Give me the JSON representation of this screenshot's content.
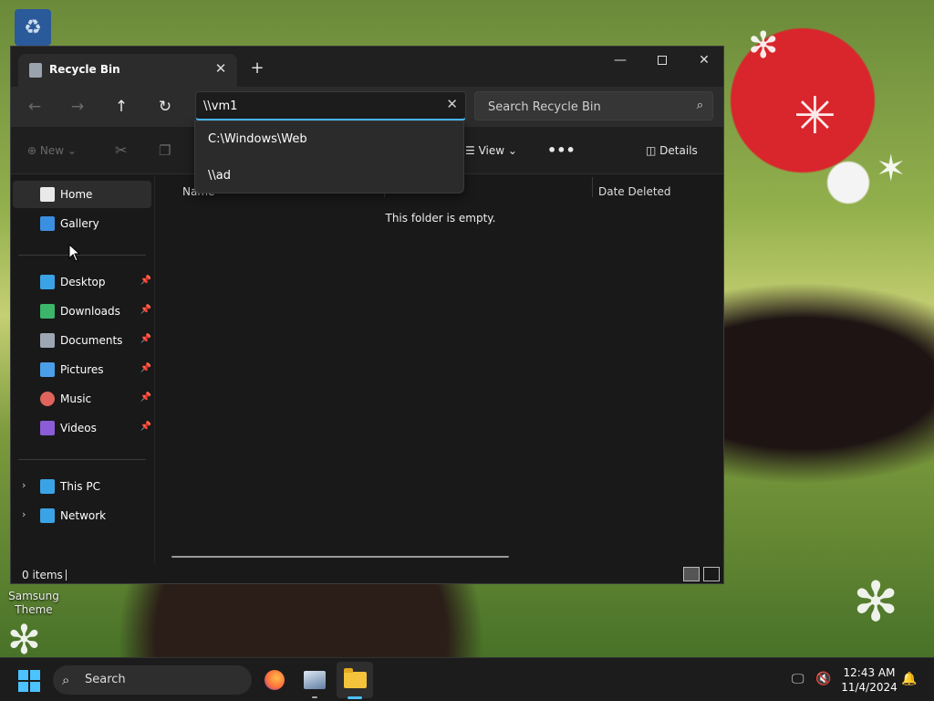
{
  "desktop": {
    "recycle_bin_icon": "recycle-bin-icon",
    "theme_label": "Samsung Theme"
  },
  "window": {
    "tab_title": "Recycle Bin",
    "tab_icon": "recycle-bin-icon",
    "tab_close": "✕",
    "new_tab": "+",
    "minimize": "—",
    "close": "✕"
  },
  "navigation": {
    "back": "←",
    "forward": "→",
    "up": "↑",
    "refresh": "↻",
    "address_value": "\\\\vm1",
    "address_clear": "✕",
    "search_placeholder": "Search Recycle Bin",
    "search_icon": "⌕"
  },
  "address_suggestions": [
    {
      "label": "C:\\Windows\\Web"
    },
    {
      "label": "\\\\ad"
    }
  ],
  "commandbar": {
    "new_label": "New",
    "new_icon": "⊕",
    "cut_icon": "✂",
    "copy_icon": "❐",
    "view_label": "View",
    "more_label": "•••",
    "details_label": "Details"
  },
  "sidebar": {
    "items": [
      {
        "label": "Home",
        "icon": "home-icon",
        "color": "#e9e9e9"
      },
      {
        "label": "Gallery",
        "icon": "gallery-icon",
        "color": "#3b8fe0"
      },
      {
        "label": "Desktop",
        "icon": "desktop-icon",
        "color": "#3aa3e6"
      },
      {
        "label": "Downloads",
        "icon": "download-icon",
        "color": "#3bb66b"
      },
      {
        "label": "Documents",
        "icon": "documents-icon",
        "color": "#9da7b3"
      },
      {
        "label": "Pictures",
        "icon": "pictures-icon",
        "color": "#4a9fe8"
      },
      {
        "label": "Music",
        "icon": "music-icon",
        "color": "#e0645c"
      },
      {
        "label": "Videos",
        "icon": "videos-icon",
        "color": "#8a5cd6"
      },
      {
        "label": "This PC",
        "icon": "this-pc-icon",
        "color": "#3aa3e6"
      },
      {
        "label": "Network",
        "icon": "network-icon",
        "color": "#3aa3e6"
      }
    ],
    "pin_glyph": "📌",
    "expand_glyph": "›"
  },
  "content": {
    "columns": [
      "Name",
      "Date Deleted"
    ],
    "empty_message": "This folder is empty."
  },
  "statusbar": {
    "item_count": "0 items"
  },
  "taskbar": {
    "search_label": "Search",
    "time": "12:43 AM",
    "date": "11/4/2024",
    "accent": "#4cc2ff"
  }
}
